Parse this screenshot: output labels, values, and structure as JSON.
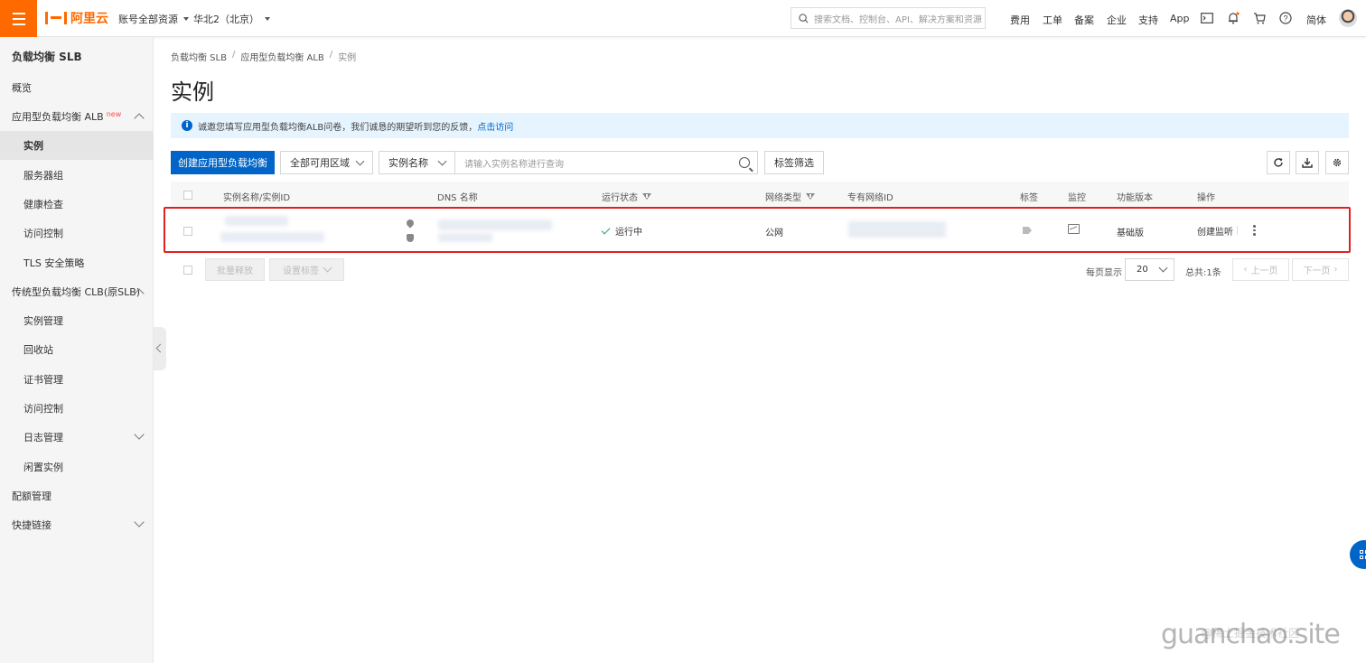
{
  "topbar": {
    "logo": "阿里云",
    "account_scope": "账号全部资源",
    "region": "华北2（北京）",
    "search_placeholder": "搜索文档、控制台、API、解决方案和资源",
    "links": [
      "费用",
      "工单",
      "备案",
      "企业",
      "支持",
      "App"
    ],
    "lang": "简体"
  },
  "sidebar": {
    "title": "负载均衡 SLB",
    "items": [
      {
        "label": "概览"
      },
      {
        "label": "应用型负载均衡 ALB",
        "badge": "new"
      },
      {
        "label": "实例"
      },
      {
        "label": "服务器组"
      },
      {
        "label": "健康检查"
      },
      {
        "label": "访问控制"
      },
      {
        "label": "TLS 安全策略"
      },
      {
        "label": "传统型负载均衡 CLB(原SLB)"
      },
      {
        "label": "实例管理"
      },
      {
        "label": "回收站"
      },
      {
        "label": "证书管理"
      },
      {
        "label": "访问控制"
      },
      {
        "label": "日志管理"
      },
      {
        "label": "闲置实例"
      },
      {
        "label": "配额管理"
      },
      {
        "label": "快捷链接"
      }
    ]
  },
  "breadcrumb": [
    "负载均衡 SLB",
    "应用型负载均衡 ALB",
    "实例"
  ],
  "page_title": "实例",
  "notice": {
    "text": "诚邀您填写应用型负载均衡ALB问卷，我们诚恳的期望听到您的反馈，",
    "link": "点击访问"
  },
  "toolbar": {
    "create_label": "创建应用型负载均衡",
    "zone_select": "全部可用区域",
    "field_select": "实例名称",
    "search_placeholder": "请输入实例名称进行查询",
    "tag_filter": "标签筛选"
  },
  "table": {
    "columns": [
      "实例名称/实例ID",
      "DNS 名称",
      "运行状态",
      "网络类型",
      "专有网络ID",
      "标签",
      "监控",
      "功能版本",
      "操作"
    ],
    "rows": [
      {
        "status": "运行中",
        "network": "公网",
        "edition": "基础版",
        "action": "创建监听"
      }
    ]
  },
  "footer": {
    "batch_release": "批量释放",
    "set_tags": "设置标签",
    "per_page_label": "每页显示",
    "per_page": "20",
    "total": "总共:1条",
    "prev": "上一页",
    "next": "下一页"
  },
  "watermark": "guanchao.site",
  "watermark_sub": "@稀土掘金技术社区",
  "colors": {
    "brand": "#ff6a00",
    "primary": "#0064c8",
    "highlight_border": "#e02020",
    "status_ok": "#22a45d"
  },
  "icons": [
    "menu-icon",
    "search-icon",
    "terminal-icon",
    "bell-icon",
    "cart-icon",
    "help-icon",
    "refresh-icon",
    "download-icon",
    "settings-icon",
    "tag-icon",
    "monitor-icon",
    "more-icon"
  ]
}
